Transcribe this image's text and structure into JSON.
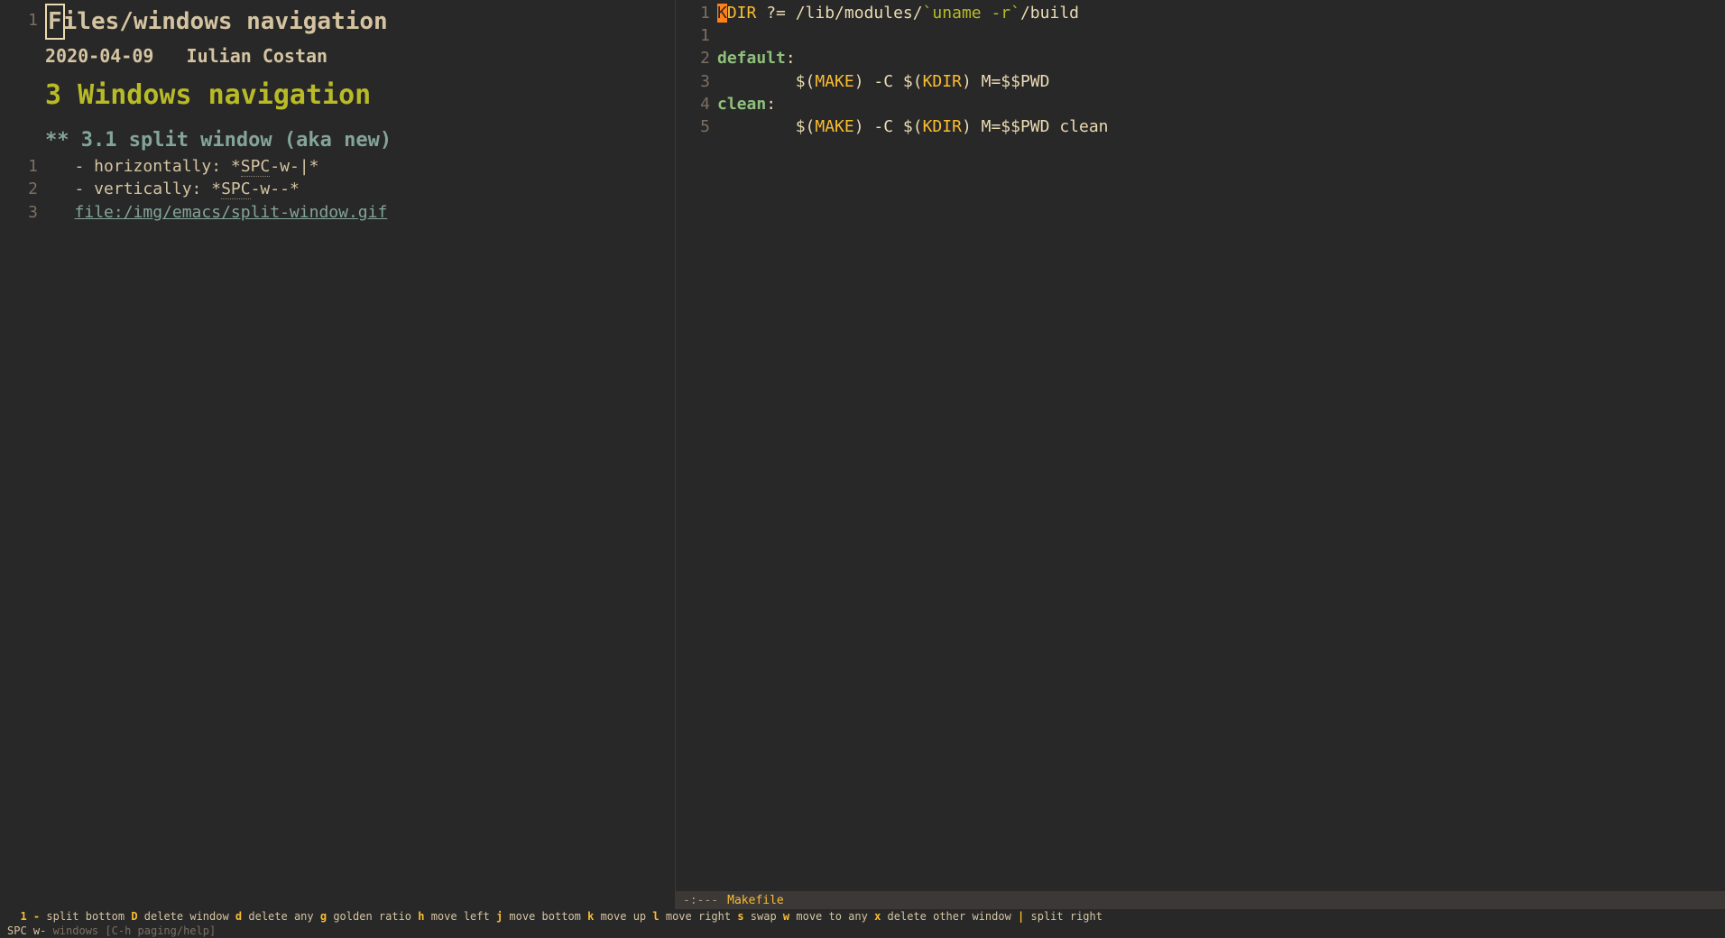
{
  "left": {
    "title_gutter": "1",
    "title_first_char": "F",
    "title_rest": "iles/windows navigation",
    "date": "2020-04-09",
    "author": "Iulian Costan",
    "heading1": "3 Windows navigation",
    "h2_gutter": "",
    "heading2": "** 3.1 split window (aka new)",
    "lines": [
      {
        "n": "1",
        "prefix": "   - horizontally: *",
        "dotted": "SPC",
        "suffix": "-w-|*"
      },
      {
        "n": "2",
        "prefix": "   - vertically: *",
        "dotted": "SPC",
        "suffix": "-w--*"
      }
    ],
    "link_line": {
      "n": "3",
      "indent": "   ",
      "text": "file:/img/emacs/split-window.gif"
    }
  },
  "right": {
    "lines": [
      {
        "n": "1",
        "type": "kdir",
        "cursor": "K",
        "var": "DIR",
        "mid": " ?= /lib/modules/",
        "str": "`uname -r`",
        "end": "/build"
      },
      {
        "n": "1",
        "type": "blank"
      },
      {
        "n": "2",
        "type": "target",
        "name": "default",
        "colon": ":"
      },
      {
        "n": "3",
        "type": "cmd",
        "indent": "        $(",
        "make": "MAKE",
        "mid": ") -C $(",
        "kdir": "KDIR",
        "end": ") M=$$PWD"
      },
      {
        "n": "4",
        "type": "target",
        "name": "clean",
        "colon": ":"
      },
      {
        "n": "5",
        "type": "cmd",
        "indent": "        $(",
        "make": "MAKE",
        "mid": ") -C $(",
        "kdir": "KDIR",
        "end": ") M=$$PWD clean"
      }
    ],
    "modeline": {
      "prefix": "-:---",
      "filename": "Makefile"
    }
  },
  "bottom": {
    "hints": [
      {
        "k": "1",
        "t": " "
      },
      {
        "k": "-",
        "t": " split bottom "
      },
      {
        "k": "D",
        "t": " delete window "
      },
      {
        "k": "d",
        "t": " delete any "
      },
      {
        "k": "g",
        "t": " golden ratio "
      },
      {
        "k": "h",
        "t": " move left "
      },
      {
        "k": "j",
        "t": " move bottom "
      },
      {
        "k": "k",
        "t": " move up "
      },
      {
        "k": "l",
        "t": " move right "
      },
      {
        "k": "s",
        "t": " swap "
      },
      {
        "k": "w",
        "t": " move to any "
      },
      {
        "k": "x",
        "t": " delete other window "
      },
      {
        "k": "|",
        "t": " split right"
      }
    ],
    "prompt_prefix": "SPC w-",
    "prompt_label": " windows ",
    "prompt_help": "[C-h paging/help]"
  }
}
